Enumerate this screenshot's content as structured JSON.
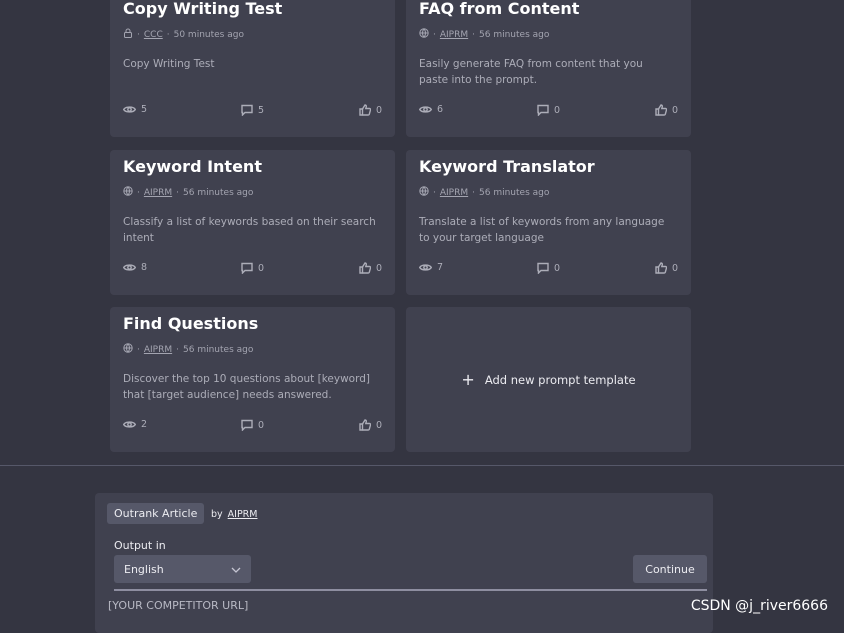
{
  "cards": [
    {
      "title": "Copy Writing Test",
      "visibility_icon": "lock-icon",
      "author": "CCC",
      "time": "50 minutes ago",
      "description": "Copy Writing Test",
      "views": "5",
      "comments": "5",
      "likes": "0"
    },
    {
      "title": "FAQ from Content",
      "visibility_icon": "globe-icon",
      "author": "AIPRM",
      "time": "56 minutes ago",
      "description": "Easily generate FAQ from content that you paste into the prompt.",
      "views": "6",
      "comments": "0",
      "likes": "0"
    },
    {
      "title": "Keyword Intent",
      "visibility_icon": "globe-icon",
      "author": "AIPRM",
      "time": "56 minutes ago",
      "description": "Classify a list of keywords based on their search intent",
      "views": "8",
      "comments": "0",
      "likes": "0"
    },
    {
      "title": "Keyword Translator",
      "visibility_icon": "globe-icon",
      "author": "AIPRM",
      "time": "56 minutes ago",
      "description": "Translate a list of keywords from any language to your target language",
      "views": "7",
      "comments": "0",
      "likes": "0"
    },
    {
      "title": "Find Questions",
      "visibility_icon": "globe-icon",
      "author": "AIPRM",
      "time": "56 minutes ago",
      "description": "Discover the top 10 questions about [keyword] that [target audience] needs answered.",
      "views": "2",
      "comments": "0",
      "likes": "0"
    }
  ],
  "add_card": {
    "label": "Add new prompt template",
    "icon": "plus-icon"
  },
  "panel": {
    "tag": "Outrank Article",
    "by": "by",
    "author": "AIPRM",
    "output_label": "Output in",
    "language": "English",
    "continue_label": "Continue",
    "input_text": "[YOUR COMPETITOR URL]"
  },
  "watermark": "CSDN @j_river6666",
  "colors": {
    "background": "#343541",
    "card": "#40414f",
    "button": "#565869"
  }
}
